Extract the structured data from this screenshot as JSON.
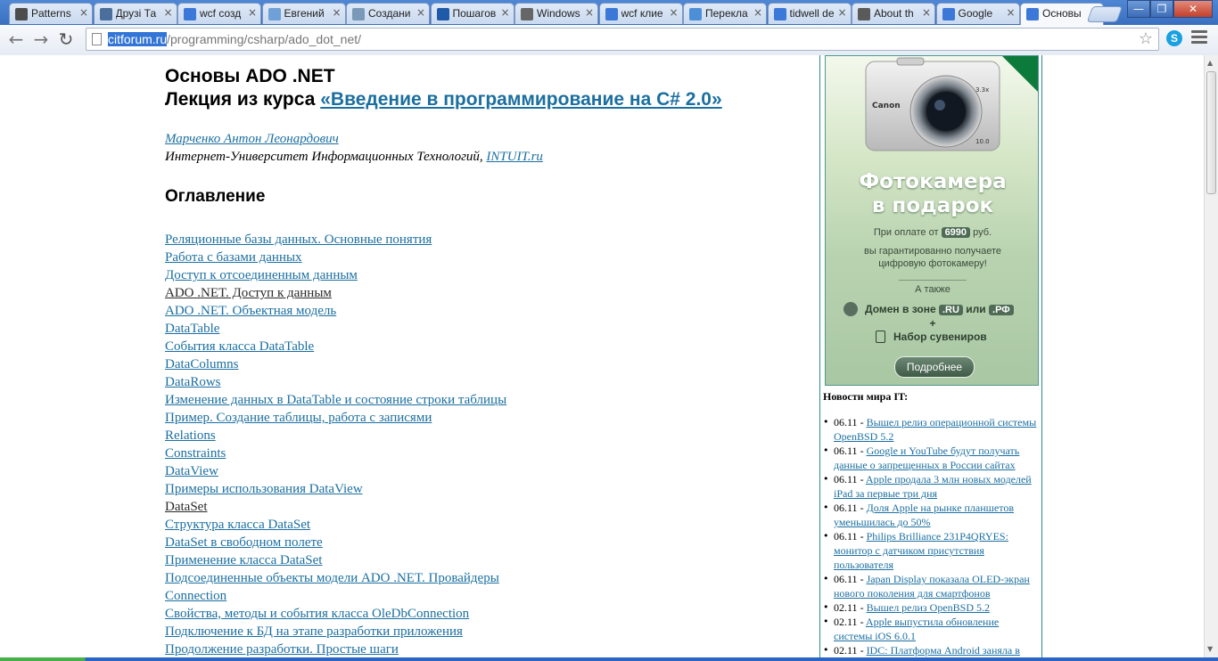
{
  "tabs": [
    {
      "title": "Patterns",
      "icon": "image-icon",
      "color": "#4d4d4d"
    },
    {
      "title": "Друзі Та",
      "icon": "vk-icon",
      "color": "#4a6f9c"
    },
    {
      "title": "wcf созд",
      "icon": "google-icon",
      "color": "#3c78d8"
    },
    {
      "title": "Евгений",
      "icon": "people-icon",
      "color": "#6fa0d8"
    },
    {
      "title": "Создани",
      "icon": "habr-icon",
      "color": "#7a98b8"
    },
    {
      "title": "Пошагов",
      "icon": "msdn-icon",
      "color": "#1e5aa8"
    },
    {
      "title": "Windows",
      "icon": "wikipedia-icon",
      "color": "#666666"
    },
    {
      "title": "wcf клие",
      "icon": "google-icon",
      "color": "#3c78d8"
    },
    {
      "title": "Перекла",
      "icon": "translate-icon",
      "color": "#4d8fd6"
    },
    {
      "title": "tidwell de",
      "icon": "google-icon",
      "color": "#3c78d8"
    },
    {
      "title": "About th",
      "icon": "image-icon",
      "color": "#5a5a5a"
    },
    {
      "title": "Google",
      "icon": "google-icon",
      "color": "#3c78d8"
    },
    {
      "title": "Основы",
      "icon": "google-icon",
      "color": "#3c78d8",
      "active": true
    }
  ],
  "toolbar": {
    "url_host": "citforum.ru",
    "url_path": "/programming/csharp/ado_dot_net/"
  },
  "article": {
    "title_line1": "Основы ADO .NET",
    "title_line2_prefix": "Лекция из курса ",
    "course_link": "«Введение в программирование на C# 2.0»",
    "author": "Марченко Антон Леонардович",
    "university_text": "Интернет-Университет Информационных Технологий, ",
    "university_link": "INTUIT.ru",
    "toc_heading": "Оглавление"
  },
  "toc": [
    {
      "label": "Реляционные базы данных. Основные понятия"
    },
    {
      "label": "Работа с базами данных"
    },
    {
      "label": "Доступ к отсоединенным данным"
    },
    {
      "label": "ADO .NET. Доступ к данным",
      "visited": true
    },
    {
      "label": "ADO .NET. Объектная модель"
    },
    {
      "label": "DataTable"
    },
    {
      "label": "События класса DataTable"
    },
    {
      "label": "DataColumns"
    },
    {
      "label": "DataRows"
    },
    {
      "label": "Изменение данных в DataTable и состояние строки таблицы"
    },
    {
      "label": "Пример. Создание таблицы, работа с записями"
    },
    {
      "label": "Relations"
    },
    {
      "label": "Constraints"
    },
    {
      "label": "DataView"
    },
    {
      "label": "Примеры использования DataView"
    },
    {
      "label": "DataSet",
      "visited": true
    },
    {
      "label": "Структура класса DataSet"
    },
    {
      "label": "DataSet в свободном полете"
    },
    {
      "label": "Применение класса DataSet"
    },
    {
      "label": "Подсоединенные объекты модели ADO .NET. Провайдеры"
    },
    {
      "label": "Connection"
    },
    {
      "label": "Свойства, методы и события класса OleDbConnection"
    },
    {
      "label": "Подключение к БД на этапе разработки приложения"
    },
    {
      "label": "Продолжение разработки. Простые шаги"
    }
  ],
  "ad": {
    "title_line1": "Фотокамера",
    "title_line2": "в подарок",
    "price_prefix": "При оплате от",
    "price_value": "6990",
    "price_suffix": "руб.",
    "guarantee_line1": "вы гарантированно получаете",
    "guarantee_line2": "цифровую фотокамеру!",
    "also": "А также",
    "domain_prefix": "Домен в зоне",
    "domain_ru": ".RU",
    "domain_or": "или",
    "domain_rf": ".РФ",
    "plus": "+",
    "souvenirs": "Набор сувениров",
    "button": "Подробнее",
    "brand": "Canon",
    "zoom_label": "3.3x",
    "megapixels": "10.0"
  },
  "news": {
    "title": "Новости мира IT:",
    "items": [
      {
        "date": "06.11",
        "text": "Вышел релиз операционной системы OpenBSD 5.2"
      },
      {
        "date": "06.11",
        "text": "Google и YouTube будут получать данные о запрещенных в России сайтах"
      },
      {
        "date": "06.11",
        "text": "Apple продала 3 млн новых моделей iPad за первые три дня"
      },
      {
        "date": "06.11",
        "text": "Доля Apple на рынке планшетов уменьшилась до 50%"
      },
      {
        "date": "06.11",
        "text": "Philips Brilliance 231P4QRYES: монитор с датчиком присутствия пользователя"
      },
      {
        "date": "06.11",
        "text": "Japan Display показала OLED-экран нового поколения для смартфонов"
      },
      {
        "date": "02.11",
        "text": "Вышел релиз OpenBSD 5.2"
      },
      {
        "date": "02.11",
        "text": "Apple выпустила обновление системы iOS 6.0.1"
      },
      {
        "date": "02.11",
        "text": "IDC: Платформа Android заняла в"
      }
    ]
  }
}
